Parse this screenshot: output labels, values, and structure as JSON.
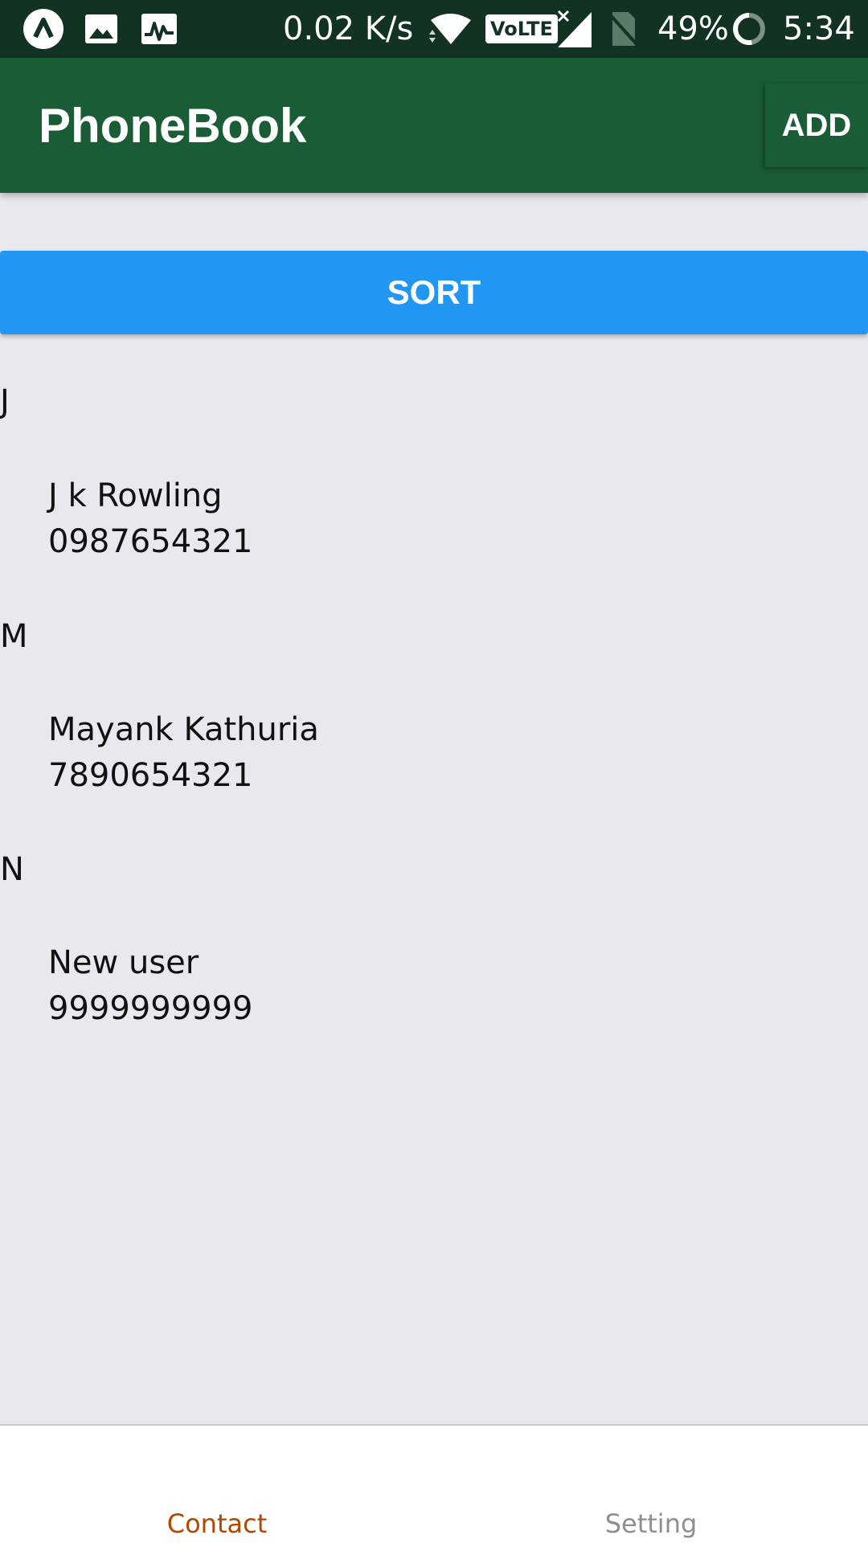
{
  "status_bar": {
    "icons": [
      "app-launcher-icon",
      "image-icon",
      "activity-icon",
      "wifi-icon",
      "volte-icon",
      "signal-icon",
      "no-sim-icon",
      "battery-icon"
    ],
    "network_speed": "0.02 K/s",
    "volte_label": "VoLTE",
    "battery": "49%",
    "time": "5:34"
  },
  "app_bar": {
    "title": "PhoneBook",
    "add_label": "ADD",
    "background": "#1a5c36"
  },
  "sort_button": {
    "label": "SORT",
    "color": "#2196f3"
  },
  "contacts": [
    {
      "letter": "J",
      "name": "J k Rowling",
      "phone": "0987654321"
    },
    {
      "letter": "M",
      "name": "Mayank Kathuria",
      "phone": "7890654321"
    },
    {
      "letter": "N",
      "name": "New user",
      "phone": "9999999999"
    }
  ],
  "tabs": [
    {
      "label": "Contact",
      "active": true,
      "color": "#b34700"
    },
    {
      "label": "Setting",
      "active": false,
      "color": "#8e8e93"
    }
  ]
}
